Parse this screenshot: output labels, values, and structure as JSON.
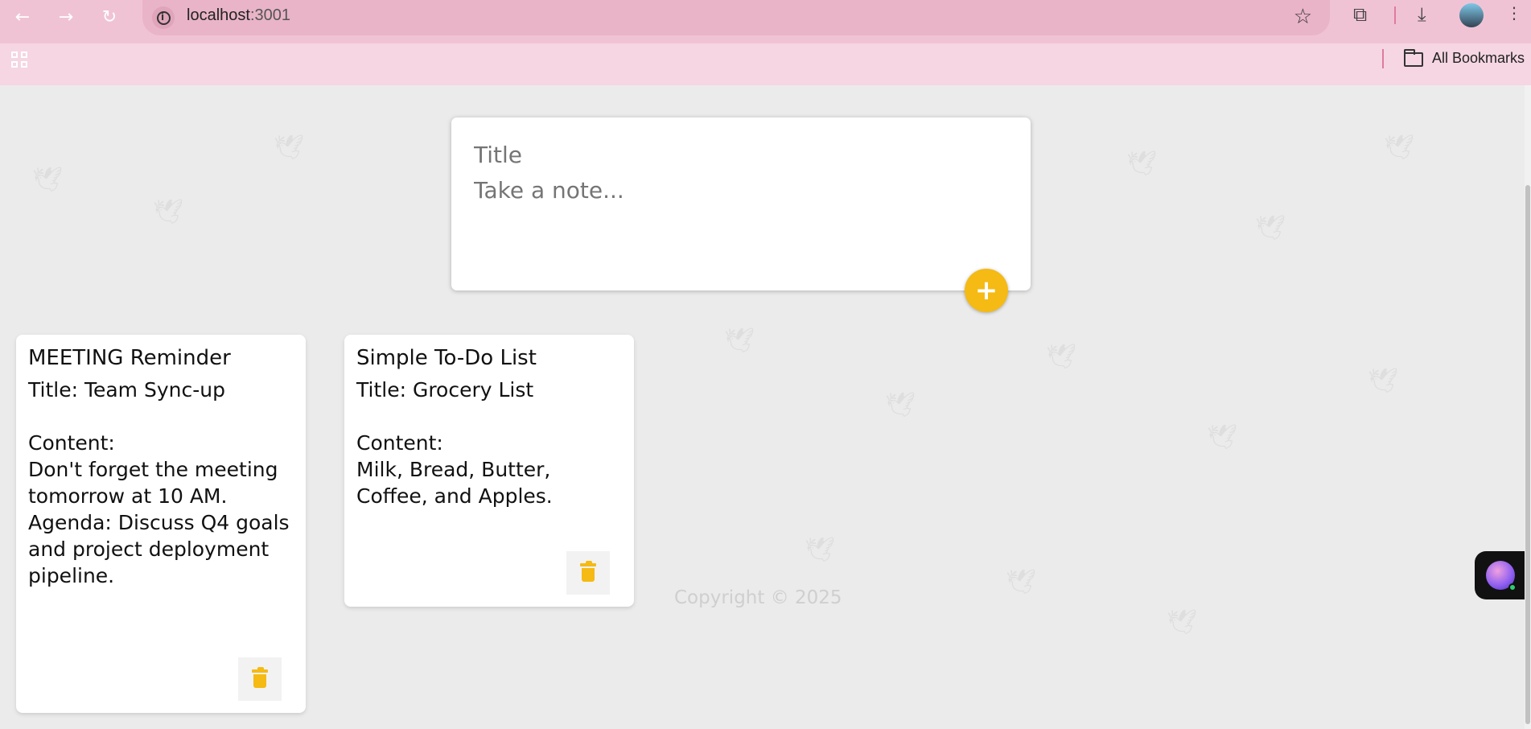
{
  "browser": {
    "url_host": "localhost",
    "url_port": ":3001",
    "bookmarks_label": "All Bookmarks"
  },
  "composer": {
    "title_placeholder": "Title",
    "content_placeholder": "Take a note...",
    "add_label": "+"
  },
  "notes": [
    {
      "title": "MEETING Reminder",
      "content": "Title: Team Sync-up\n\nContent:\nDon't forget the meeting tomorrow at 10 AM.\nAgenda: Discuss Q4 goals and project deployment pipeline."
    },
    {
      "title": "Simple To-Do List",
      "content": "Title: Grocery List\n\nContent:\nMilk, Bread, Butter, Coffee, and Apples."
    }
  ],
  "footer": {
    "copyright": "Copyright © 2025"
  },
  "colors": {
    "accent": "#f5ba13",
    "tab_bar": "#f0c3d4",
    "bookmark_bar": "#f5d6e2",
    "page_bg": "#ebebeb"
  }
}
